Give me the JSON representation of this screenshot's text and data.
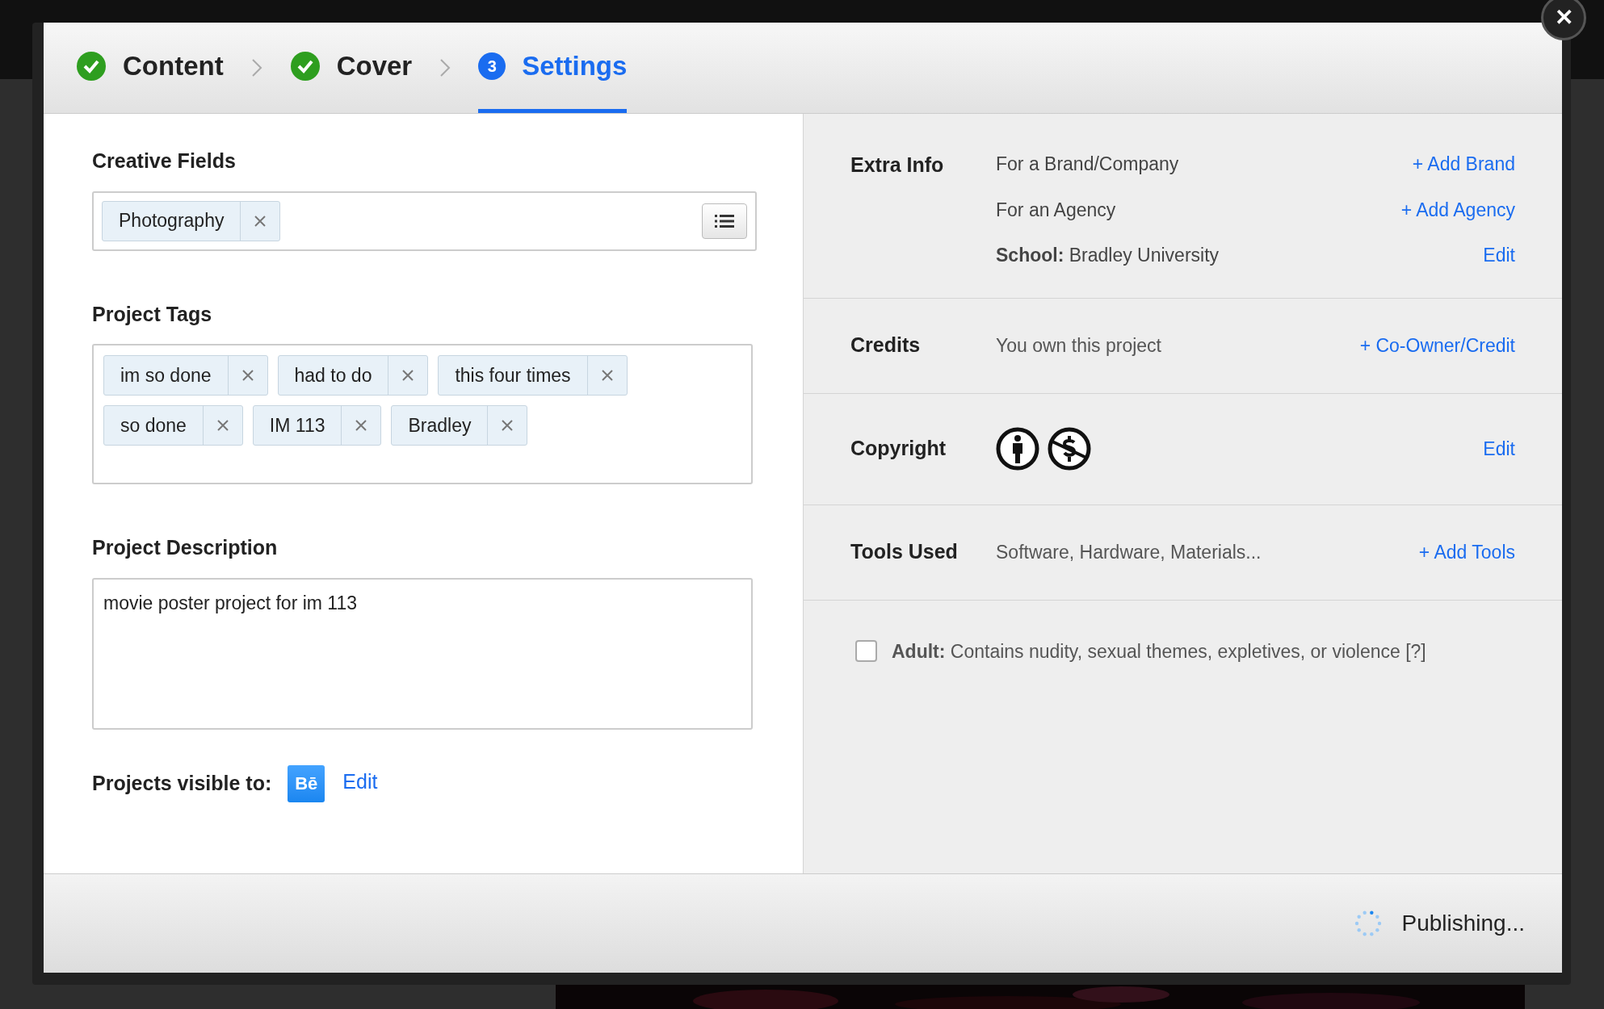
{
  "steps": [
    {
      "label": "Content",
      "kind": "done",
      "selected": false
    },
    {
      "label": "Cover",
      "kind": "done",
      "selected": false
    },
    {
      "label": "Settings",
      "kind": "number",
      "number": "3",
      "selected": true
    }
  ],
  "creative_fields": {
    "label": "Creative Fields",
    "tags": [
      "Photography"
    ]
  },
  "project_tags": {
    "label": "Project Tags",
    "tags": [
      "im so done",
      "had to do",
      "this four times",
      "so done",
      "IM 113",
      "Bradley"
    ]
  },
  "project_description": {
    "label": "Project Description",
    "value": "movie poster project for im 113"
  },
  "visibility": {
    "label": "Projects visible to:",
    "badge": "Bē",
    "link": "Edit"
  },
  "extra_info": {
    "label": "Extra Info",
    "rows": [
      {
        "text": "For a Brand/Company",
        "action": "+ Add Brand"
      },
      {
        "text": "For an Agency",
        "action": "+ Add Agency"
      },
      {
        "text": "**School:** Bradley University",
        "action": "Edit"
      }
    ]
  },
  "credits": {
    "label": "Credits",
    "text": "You own this project",
    "action": "+ Co-Owner/Credit"
  },
  "copyright": {
    "label": "Copyright",
    "action": "Edit"
  },
  "tools_used": {
    "label": "Tools Used",
    "text": "Software, Hardware, Materials...",
    "action": "+ Add Tools"
  },
  "adult": {
    "checked": false,
    "text": "**Adult:** Contains nudity, sexual themes, expletives, or violence [?]"
  },
  "footer": {
    "status": "Publishing..."
  },
  "close": "✕"
}
